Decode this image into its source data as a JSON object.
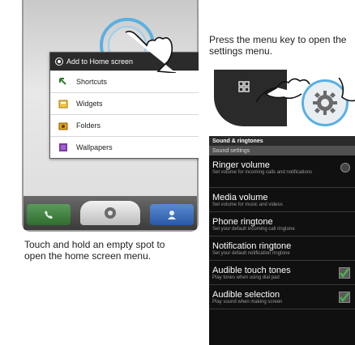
{
  "left_screen": {
    "menu_title": "Add to Home screen",
    "menu_items": [
      {
        "label": "Shortcuts",
        "icon": "shortcut-icon"
      },
      {
        "label": "Widgets",
        "icon": "widgets-icon"
      },
      {
        "label": "Folders",
        "icon": "folder-icon"
      },
      {
        "label": "Wallpapers",
        "icon": "wallpaper-icon"
      }
    ],
    "caption": "Touch and hold an empty spot to open the home screen menu."
  },
  "right_screen": {
    "caption": "Press the menu key to open the settings menu.",
    "title": "Sound & ringtones",
    "section": "Sound settings",
    "settings": [
      {
        "name": "Ringer volume",
        "desc": "Set volume for incoming calls and notifications"
      },
      {
        "name": "Media volume",
        "desc": "Set volume for music and videos"
      },
      {
        "name": "Phone ringtone",
        "desc": "Set your default incoming call ringtone"
      },
      {
        "name": "Notification ringtone",
        "desc": "Set your default notification ringtone"
      },
      {
        "name": "Audible touch tones",
        "desc": "Play tones when using dial pad"
      },
      {
        "name": "Audible selection",
        "desc": "Play sound when making screen"
      }
    ]
  },
  "colors": {
    "accent_ring": "#5ab0e0",
    "check_green": "#4caf50"
  }
}
